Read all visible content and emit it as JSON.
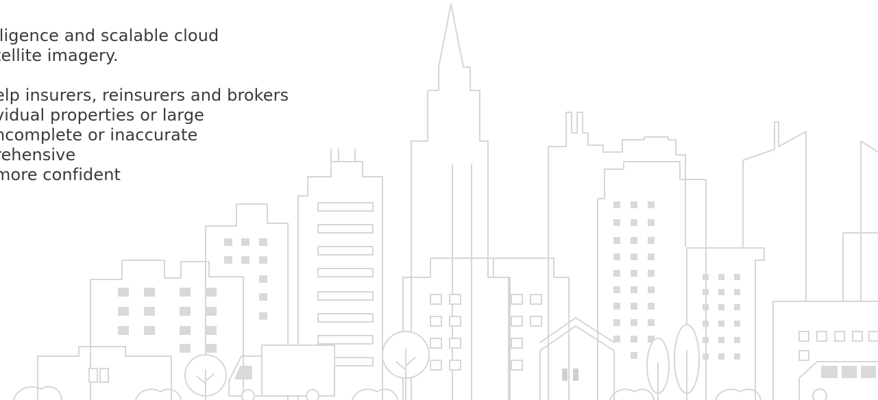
{
  "intro": {
    "paragraph1": [
      "lligence and scalable cloud",
      "tellite imagery."
    ],
    "paragraph2": [
      "elp insurers, reinsurers and brokers",
      "vidual properties or large",
      "ncomplete or inaccurate",
      "rehensive",
      "more confident"
    ]
  },
  "colors": {
    "text": "#3a3a3a",
    "line": "#d6d6d6",
    "window_fill": "#d9d9d9",
    "background": "#ffffff"
  },
  "illustration": {
    "icon": "city-skyline-line-art"
  }
}
